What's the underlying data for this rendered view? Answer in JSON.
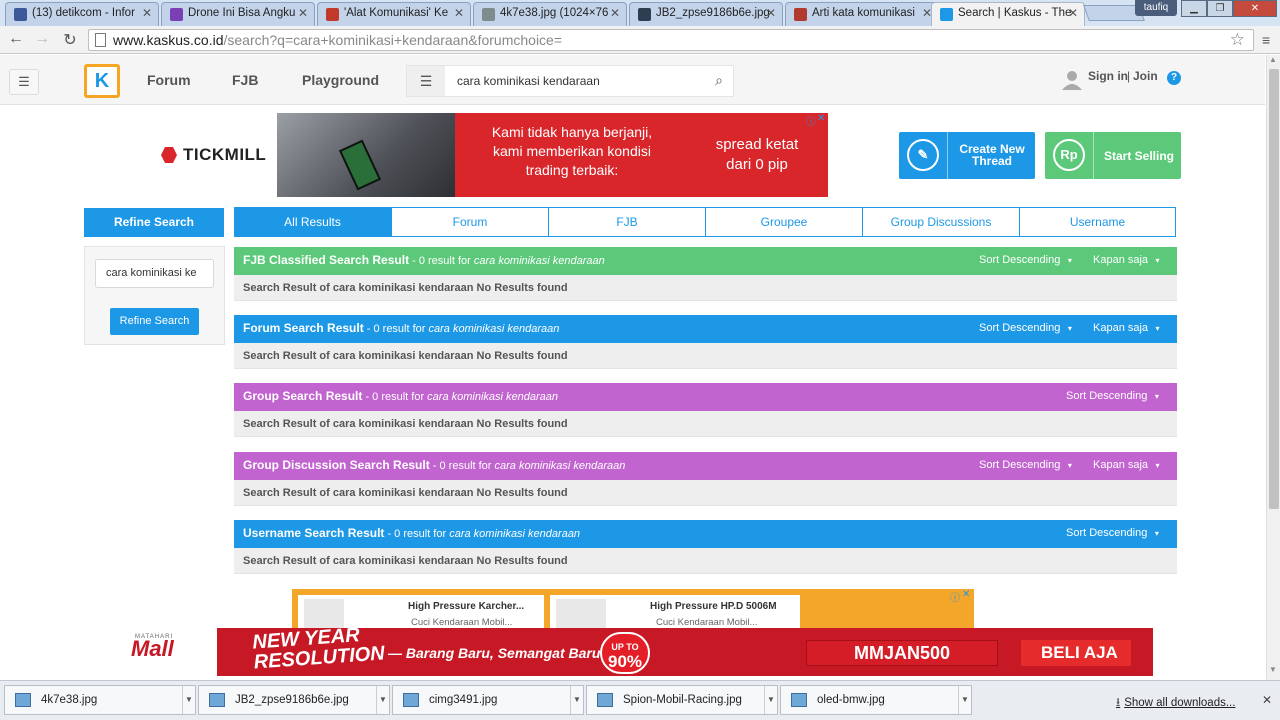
{
  "browser": {
    "tabs": [
      {
        "title": "(13) detikcom - Infor",
        "icon_color": "#3b5998"
      },
      {
        "title": "Drone Ini Bisa Angku",
        "icon_color": "#7b3fb5"
      },
      {
        "title": "'Alat Komunikasi' Ke",
        "icon_color": "#c0392b"
      },
      {
        "title": "4k7e38.jpg (1024×76",
        "icon_color": "#7f8c8d"
      },
      {
        "title": "JB2_zpse9186b6e.jpg",
        "icon_color": "#2c3e50"
      },
      {
        "title": "Arti kata komunikasi",
        "icon_color": "#b03a2e"
      },
      {
        "title": "Search | Kaskus - The",
        "icon_color": "#1c98e7"
      }
    ],
    "user": "taufiq",
    "url_host": "www.kaskus.co.id",
    "url_rest": "/search?q=cara+kominikasi+kendaraan&forumchoice="
  },
  "header": {
    "nav": [
      "Forum",
      "FJB",
      "Playground"
    ],
    "search_value": "cara kominikasi kendaraan",
    "signin": "Sign in",
    "sep": "|",
    "join": "Join",
    "help": "?"
  },
  "ad_top": {
    "brand": "TICKMILL",
    "line1": "Kami tidak hanya berjanji, kami memberikan kondisi trading terbaik:",
    "line2": "spread ketat dari 0 pip"
  },
  "actions": {
    "create": "Create New Thread",
    "sell": "Start Selling",
    "sell_icon": "Rp"
  },
  "sidebar": {
    "title": "Refine Search",
    "input": "cara kominikasi ke",
    "button": "Refine Search"
  },
  "result_tabs": [
    "All Results",
    "Forum",
    "FJB",
    "Groupee",
    "Group Discussions",
    "Username"
  ],
  "query": "cara kominikasi kendaraan",
  "sections": [
    {
      "title": "FJB Classified Search Result",
      "summary": " - 0 result for ",
      "color": "#5cc97a",
      "sort": "Sort Descending",
      "time": "Kapan saja",
      "body": "Search Result of cara kominikasi kendaraan No Results found"
    },
    {
      "title": "Forum Search Result",
      "summary": " - 0 result for ",
      "color": "#1c98e7",
      "sort": "Sort Descending",
      "time": "Kapan saja",
      "body": "Search Result of cara kominikasi kendaraan No Results found"
    },
    {
      "title": "Group Search Result",
      "summary": " - 0 result for ",
      "color": "#c264d0",
      "sort": "Sort Descending",
      "time": "",
      "body": "Search Result of cara kominikasi kendaraan No Results found"
    },
    {
      "title": "Group Discussion Search Result",
      "summary": " - 0 result for ",
      "color": "#c264d0",
      "sort": "Sort Descending",
      "time": "Kapan saja",
      "body": "Search Result of cara kominikasi kendaraan No Results found"
    },
    {
      "title": "Username Search Result",
      "summary": " - 0 result for ",
      "color": "#1c98e7",
      "sort": "Sort Descending",
      "time": "",
      "body": "Search Result of cara kominikasi kendaraan No Results found"
    }
  ],
  "ad_bottom": {
    "card1_title": "High Pressure Karcher...",
    "card1_sub": "Cuci Kendaraan Mobil...",
    "card2_title": "High Pressure HP.D 5006M",
    "card2_sub": "Cuci Kendaraan Mobil..."
  },
  "mall": {
    "tiny": "MATAHARI",
    "logo": "Mall",
    "headline1": "NEW YEAR",
    "headline2": "RESOLUTION",
    "tagline": "— Barang Baru, Semangat Baru -",
    "disc_top": "UP TO",
    "disc_val": "90%",
    "promo": "MMJAN500",
    "buy": "BELI AJA"
  },
  "downloads": {
    "items": [
      "4k7e38.jpg",
      "JB2_zpse9186b6e.jpg",
      "cimg3491.jpg",
      "Spion-Mobil-Racing.jpg",
      "oled-bmw.jpg"
    ],
    "show_all": "Show all downloads..."
  }
}
